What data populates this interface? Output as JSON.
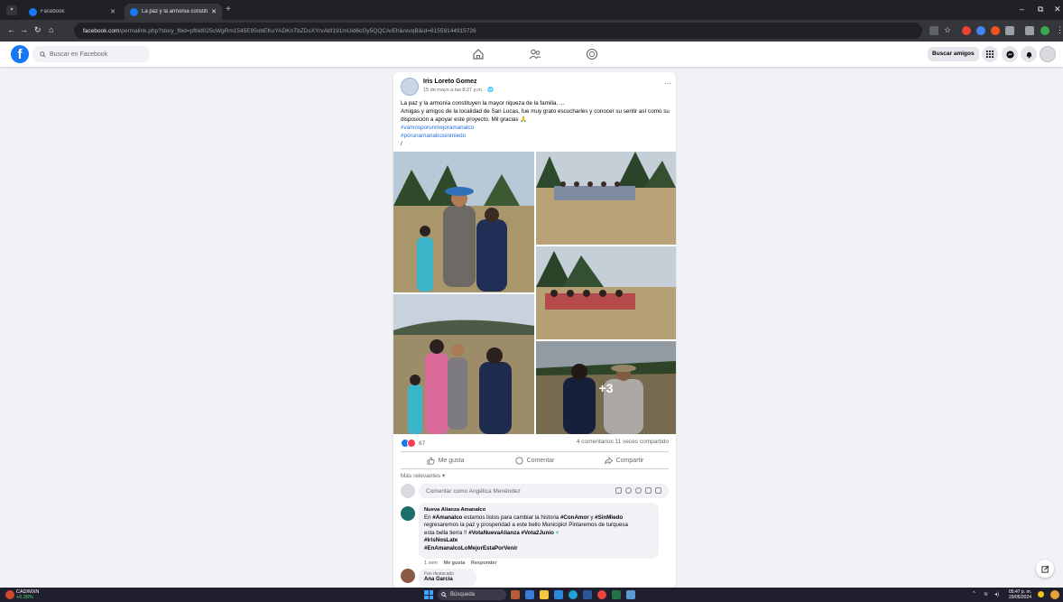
{
  "browser": {
    "tabs": [
      {
        "label": "Facebook",
        "active": false
      },
      {
        "label": "La paz y la armonía constituye",
        "active": true
      }
    ],
    "url_host": "facebook.com",
    "url_path": "/permalink.php?story_fbid=pfbid025cWgRm1545E95obEKuYADKnTbZDsXYrvAbf191mUid6cGy5QQCArEh&revqB&id=61559144915726"
  },
  "fb": {
    "search_placeholder": "Buscar en Facebook",
    "find_friends": "Buscar amigos"
  },
  "post": {
    "author": "Iris Loreto Gomez",
    "date": "15 de mayo a las 8:27 p.m. · ",
    "more": "···",
    "text_line1": "La paz y la armonía constituyen la mayor riqueza de la familia. ...",
    "text_line2": "Amigas y amigos de la localidad de San Lucas, fue muy grato escucharles y conocer su sentir así como su disposición a apoyar este proyecto. Mil gracias 🙏",
    "hashtag1": "#vamosporunmejoramanalco",
    "hashtag2": "#porunamanalcosinmiedo",
    "slash": "/",
    "more_photos": "+3",
    "reaction_count": "87",
    "comments_shares": "4 comentarios  11 veces compartido",
    "like": "Me gusta",
    "comment": "Comentar",
    "share": "Compartir",
    "relevance": "Más relevantes ▾",
    "compose_placeholder": "Comentar como Angélica Menéndez"
  },
  "comment1": {
    "author": "Nueva Alianza Amanalco",
    "l1a": "En ",
    "l1b": "#Amanalco",
    "l1c": " estamos listos para cambiar la historia ",
    "l1d": "#ConAmor",
    "l1e": " y ",
    "l1f": "#SinMiedo",
    "l2": "regresaremos la paz y prosperidad a este bello Municipio! Pintaremos de turquesa",
    "l3a": "esta bella tierra !! ",
    "l3b": "#VotaNuevaAlianza #Vota2Junio",
    "l4": "#IrisNosLate",
    "l5": "#EnAmanalcoLoMejorEstaPorVenir",
    "time": "1 sem",
    "like": "Me gusta",
    "reply": "Responder"
  },
  "comment2": {
    "badge": "Fan destacado",
    "author": "Ana Garcia"
  },
  "taskbar": {
    "ticker_name": "CAD/MXN",
    "ticker_change": "+0.38%",
    "search": "Búsqueda",
    "time": "05:47 p. m.",
    "date": "29/05/2024"
  },
  "colors": {
    "fb_blue": "#1877f2",
    "hashtag": "#216fdb"
  }
}
